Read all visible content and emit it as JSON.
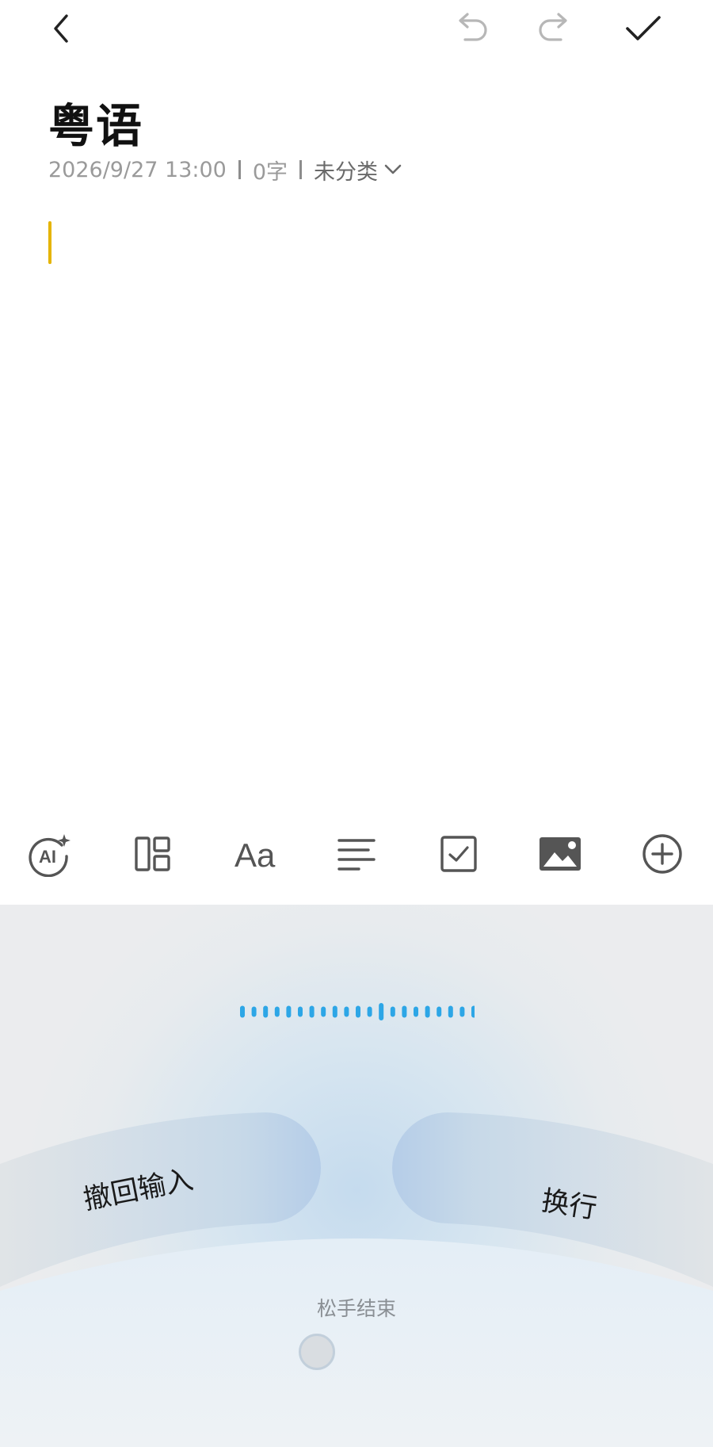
{
  "header": {
    "back_icon": "chevron-left-icon",
    "undo_icon": "undo-icon",
    "redo_icon": "redo-icon",
    "done_icon": "checkmark-icon"
  },
  "note": {
    "title": "粤语",
    "datetime": "2026/9/27 13:00",
    "word_count": "0字",
    "category": "未分类",
    "body": ""
  },
  "toolbar": {
    "items": [
      {
        "name": "ai-assistant",
        "icon": "ai-sparkle-icon",
        "label": "AI"
      },
      {
        "name": "layout",
        "icon": "layout-template-icon"
      },
      {
        "name": "text-format",
        "icon": "font-format-icon",
        "label": "Aa"
      },
      {
        "name": "paragraph",
        "icon": "align-left-icon"
      },
      {
        "name": "checklist",
        "icon": "checkbox-icon"
      },
      {
        "name": "insert-image",
        "icon": "image-icon"
      },
      {
        "name": "more",
        "icon": "plus-circle-icon"
      }
    ]
  },
  "voice": {
    "cancel_label": "撤回输入",
    "newline_label": "换行",
    "release_hint": "松手结束",
    "wave_color": "#2da6e6"
  },
  "colors": {
    "caret": "#e5b400",
    "text_primary": "#111111",
    "text_secondary": "#9a9a9a",
    "waveform": "#2da6e6"
  }
}
